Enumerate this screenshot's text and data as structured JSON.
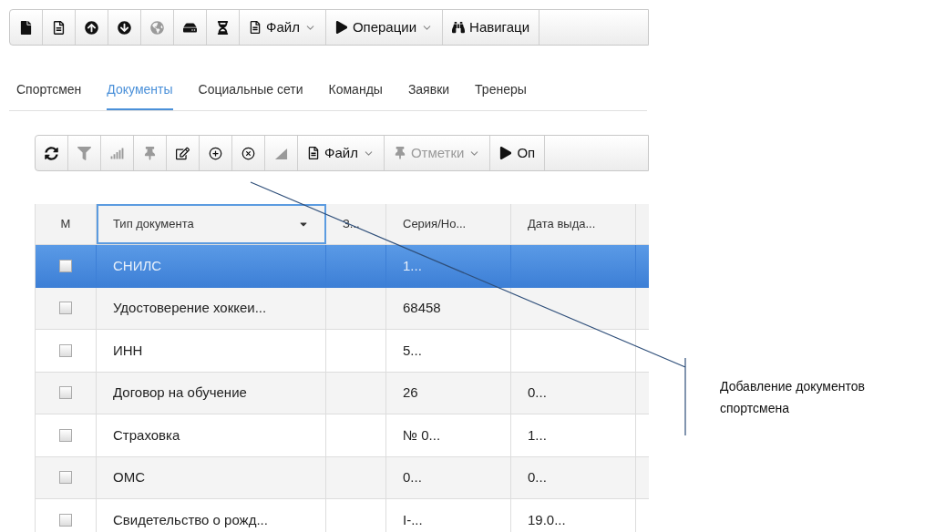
{
  "toolbar": [
    {
      "kind": "icon",
      "disabled": false
    },
    {
      "kind": "icon",
      "disabled": false
    },
    {
      "kind": "icon",
      "disabled": false
    },
    {
      "kind": "icon",
      "disabled": false
    },
    {
      "kind": "icon",
      "disabled": true
    },
    {
      "kind": "icon",
      "disabled": false
    },
    {
      "kind": "icon",
      "disabled": false
    },
    {
      "kind": "menu",
      "label": "Файл",
      "caret": true,
      "disabled": false
    },
    {
      "kind": "menu",
      "label": "Операции",
      "caret": true,
      "disabled": false
    },
    {
      "kind": "menu",
      "label": "Навигаци",
      "caret": false,
      "disabled": false
    }
  ],
  "tabs": [
    {
      "label": "Спортсмен",
      "selected": false
    },
    {
      "label": "Документы",
      "selected": true
    },
    {
      "label": "Социальные сети",
      "selected": false
    },
    {
      "label": "Команды",
      "selected": false
    },
    {
      "label": "Заявки",
      "selected": false
    },
    {
      "label": "Тренеры",
      "selected": false
    }
  ],
  "grid_toolbar": [
    {
      "kind": "icon",
      "disabled": false
    },
    {
      "kind": "icon",
      "disabled": true
    },
    {
      "kind": "icon",
      "disabled": true
    },
    {
      "kind": "icon",
      "disabled": true
    },
    {
      "kind": "icon",
      "disabled": false
    },
    {
      "kind": "icon",
      "disabled": false
    },
    {
      "kind": "icon",
      "disabled": false
    },
    {
      "kind": "icon",
      "disabled": true
    },
    {
      "kind": "menu",
      "label": "Файл",
      "caret": true,
      "disabled": false
    },
    {
      "kind": "menu",
      "label": "Отметки",
      "caret": true,
      "disabled": true
    },
    {
      "kind": "menu",
      "label": "Оп",
      "caret": false,
      "disabled": false
    }
  ],
  "table": {
    "checkbox_column": "М",
    "columns": [
      {
        "label": "Тип документа",
        "focused": true
      },
      {
        "label": "З...",
        "focused": false
      },
      {
        "label": "Серия/Но...",
        "focused": false
      },
      {
        "label": "Дата выда...",
        "focused": false
      }
    ],
    "rows": [
      {
        "selected": true,
        "checked": false,
        "cells": [
          "СНИЛС",
          "",
          "1...",
          ""
        ]
      },
      {
        "selected": false,
        "checked": false,
        "cells": [
          "Удостоверение хоккеи...",
          "",
          "68458",
          ""
        ]
      },
      {
        "selected": false,
        "checked": false,
        "cells": [
          "ИНН",
          "",
          "5...",
          ""
        ]
      },
      {
        "selected": false,
        "checked": false,
        "cells": [
          "Договор на обучение",
          "",
          "26",
          "0..."
        ]
      },
      {
        "selected": false,
        "checked": false,
        "cells": [
          "Страховка",
          "",
          "№ 0...",
          "1..."
        ]
      },
      {
        "selected": false,
        "checked": false,
        "cells": [
          "ОМС",
          "",
          "0...",
          "0..."
        ]
      },
      {
        "selected": false,
        "checked": false,
        "cells": [
          "Свидетельство о рожд...",
          "",
          "I-...",
          "19.0..."
        ]
      }
    ]
  },
  "callout": {
    "text": "Добавление документов спортсмена"
  }
}
